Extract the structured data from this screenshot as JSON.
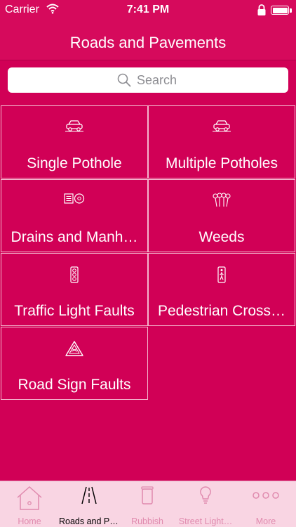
{
  "status_bar": {
    "carrier": "Carrier",
    "time": "7:41 PM"
  },
  "nav": {
    "title": "Roads and Pavements"
  },
  "search": {
    "placeholder": "Search"
  },
  "tiles": [
    {
      "label": "Single Pothole",
      "icon": "car-icon"
    },
    {
      "label": "Multiple Potholes",
      "icon": "car-icon"
    },
    {
      "label": "Drains and Manh…",
      "icon": "drain-manhole-icon"
    },
    {
      "label": "Weeds",
      "icon": "weeds-icon"
    },
    {
      "label": "Traffic Light Faults",
      "icon": "traffic-light-icon"
    },
    {
      "label": "Pedestrian Cross…",
      "icon": "pedestrian-signal-icon"
    },
    {
      "label": "Road Sign Faults",
      "icon": "road-sign-icon"
    }
  ],
  "tab_bar": {
    "tabs": [
      {
        "label": "Home",
        "icon": "home-icon",
        "active": false
      },
      {
        "label": "Roads and Pa…",
        "icon": "road-icon",
        "active": true
      },
      {
        "label": "Rubbish",
        "icon": "bin-icon",
        "active": false
      },
      {
        "label": "Street Light…",
        "icon": "lightbulb-icon",
        "active": false
      },
      {
        "label": "More",
        "icon": "more-icon",
        "active": false
      }
    ]
  },
  "colors": {
    "background": "#D10056",
    "tile_border": "#F4B6CD",
    "tab_bar": "#F9D5E3",
    "tab_inactive": "#E08AAE"
  }
}
